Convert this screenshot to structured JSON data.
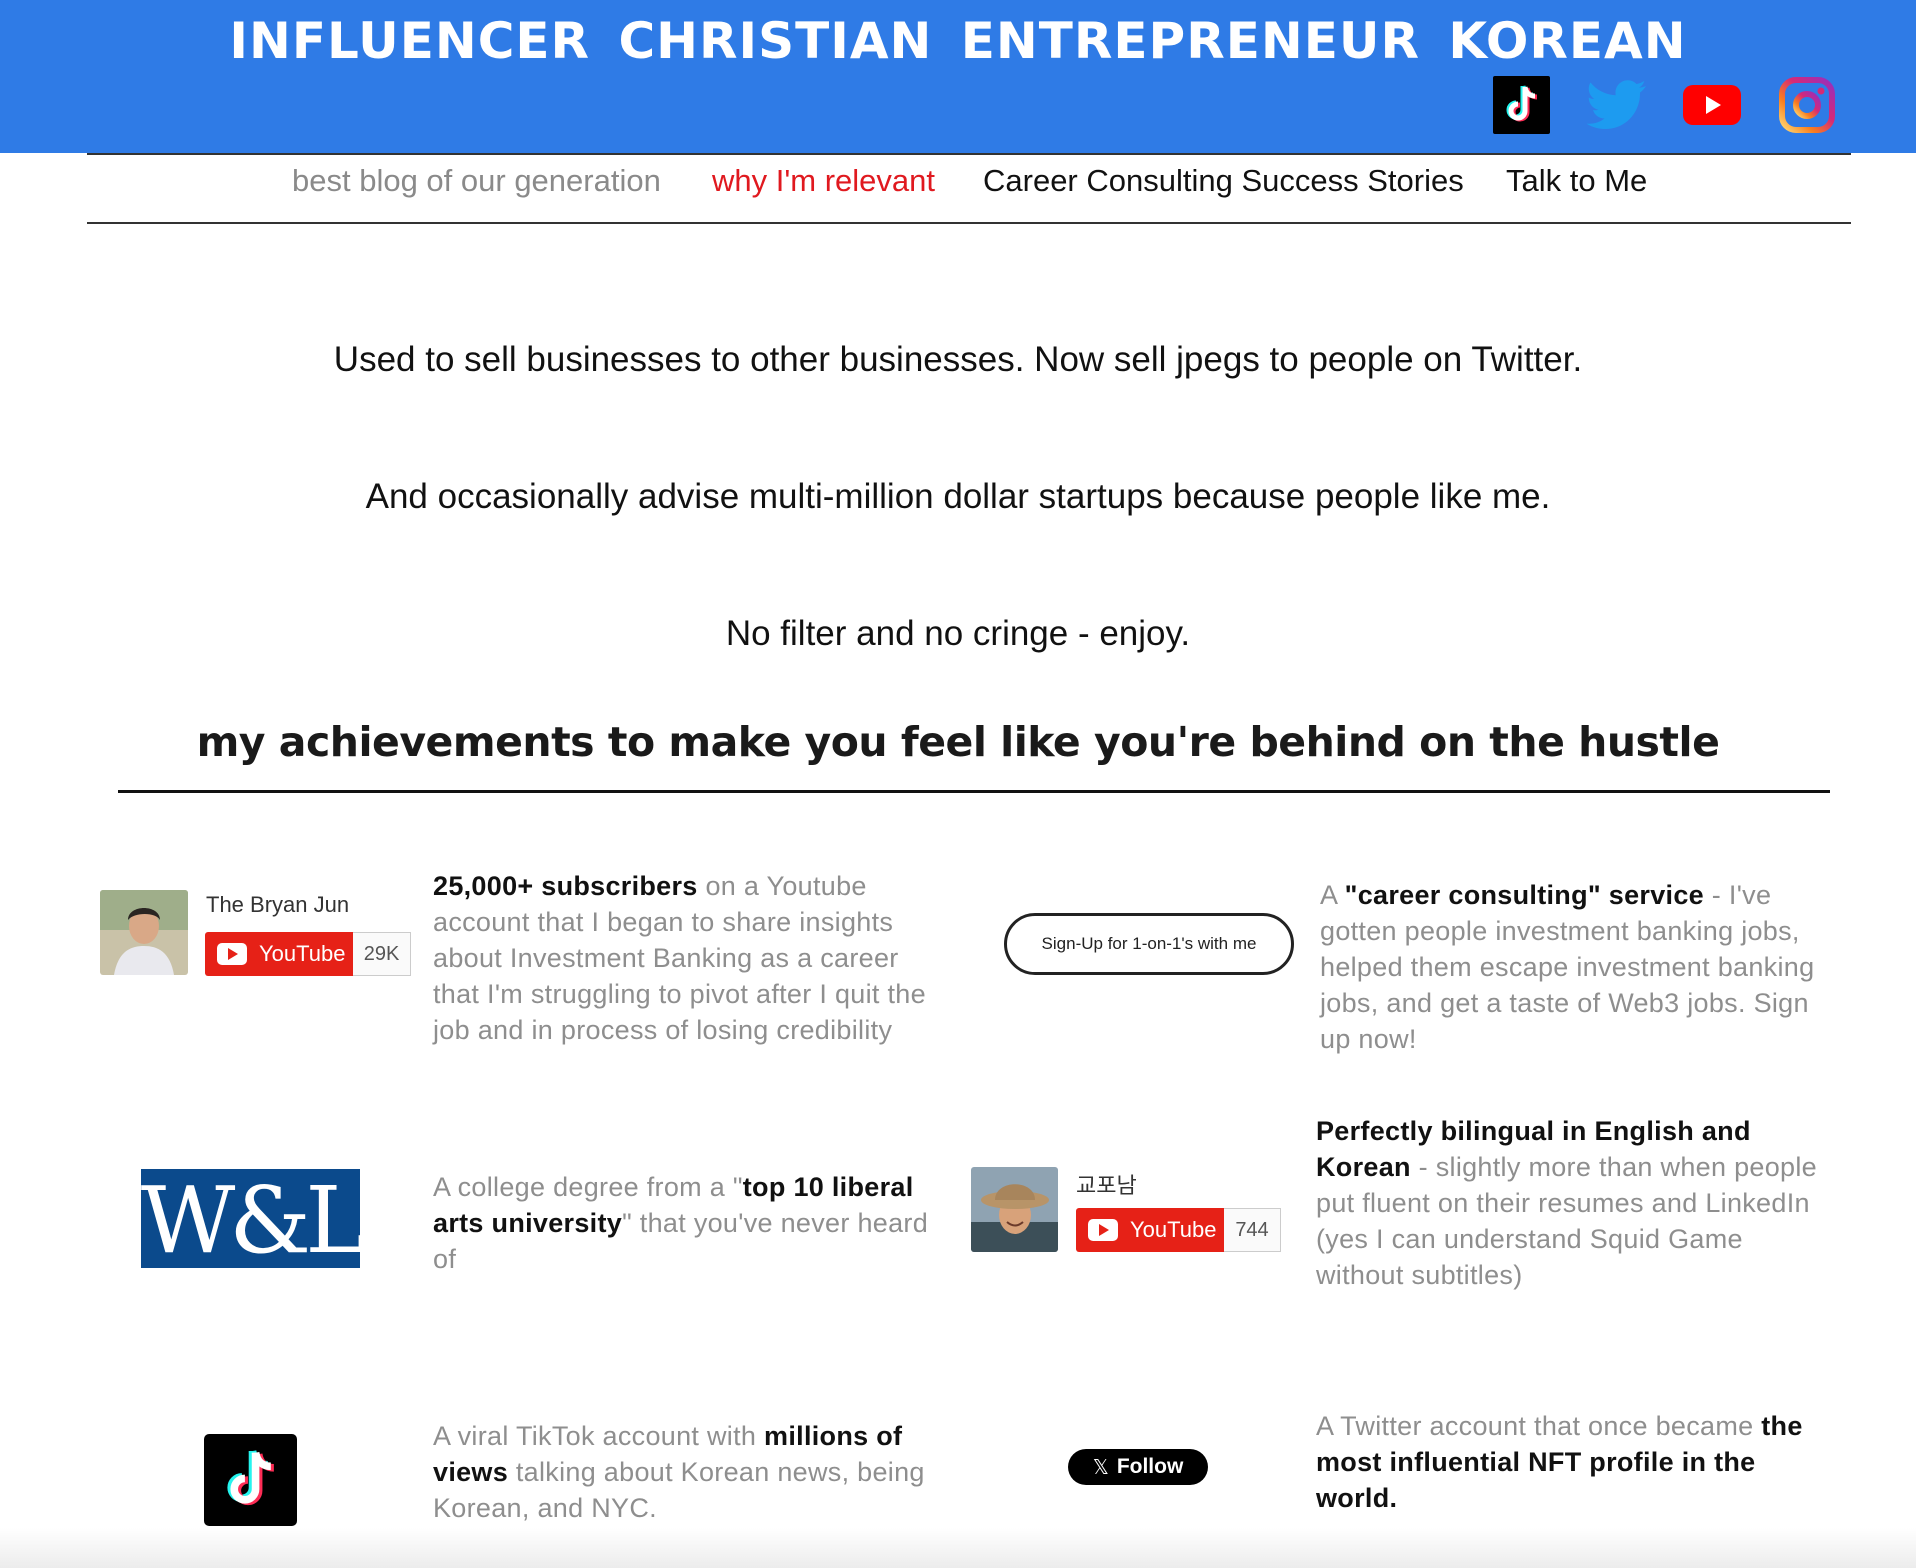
{
  "header": {
    "title": "INFLUENCER CHRISTIAN ENTREPRENEUR KOREAN",
    "social_icons": [
      "tiktok-icon",
      "twitter-icon",
      "youtube-icon",
      "instagram-icon"
    ]
  },
  "nav": {
    "items": [
      {
        "label": "best blog of our generation"
      },
      {
        "label": "why I'm relevant"
      },
      {
        "label": "Career Consulting Success Stories"
      },
      {
        "label": "Talk to Me"
      }
    ]
  },
  "intro": {
    "line1": "Used to sell businesses to other businesses. Now sell jpegs to people on Twitter.",
    "line2": "And occasionally advise multi-million dollar startups because people like me.",
    "line3": "No filter and no cringe - enjoy."
  },
  "achievements": {
    "heading": "my achievements to make you feel like you're behind on the hustle",
    "youtube1": {
      "channel": "The Bryan Jun",
      "button": "YouTube",
      "count": "29K",
      "bold": "25,000+ subscribers",
      "text": " on a Youtube account that I began to share insights about Investment Banking as a career that I'm struggling to pivot after I quit the job and in process of losing credibility"
    },
    "consulting": {
      "button": "Sign-Up for 1-on-1's with me",
      "pre": "A ",
      "bold": "\"career consulting\" service",
      "text": " - I've gotten people investment banking jobs, helped them escape investment banking jobs, and get a taste of Web3 jobs. Sign up now!"
    },
    "college": {
      "logo": "W&L",
      "pre": "A college degree from a \"",
      "bold": "top 10 liberal arts university",
      "text": "\" that you've never heard of"
    },
    "youtube2": {
      "channel": "교포남",
      "button": "YouTube",
      "count": "744",
      "bold": "Perfectly bilingual in English and Korean",
      "text": " - slightly more than when people put fluent on their resumes and LinkedIn (yes I can understand Squid Game without subtitles)"
    },
    "tiktok": {
      "pre": "A viral TikTok account with ",
      "bold": "millions of views",
      "text": " talking about Korean news, being Korean, and NYC."
    },
    "twitter": {
      "button": "Follow",
      "pre": "A Twitter account that once became ",
      "bold": "the most influential NFT profile in the world."
    }
  },
  "colors": {
    "header_bg": "#2f7be6",
    "nav_active": "#e0191f",
    "youtube_red": "#e62117",
    "wl_blue": "#0b4a8c"
  }
}
